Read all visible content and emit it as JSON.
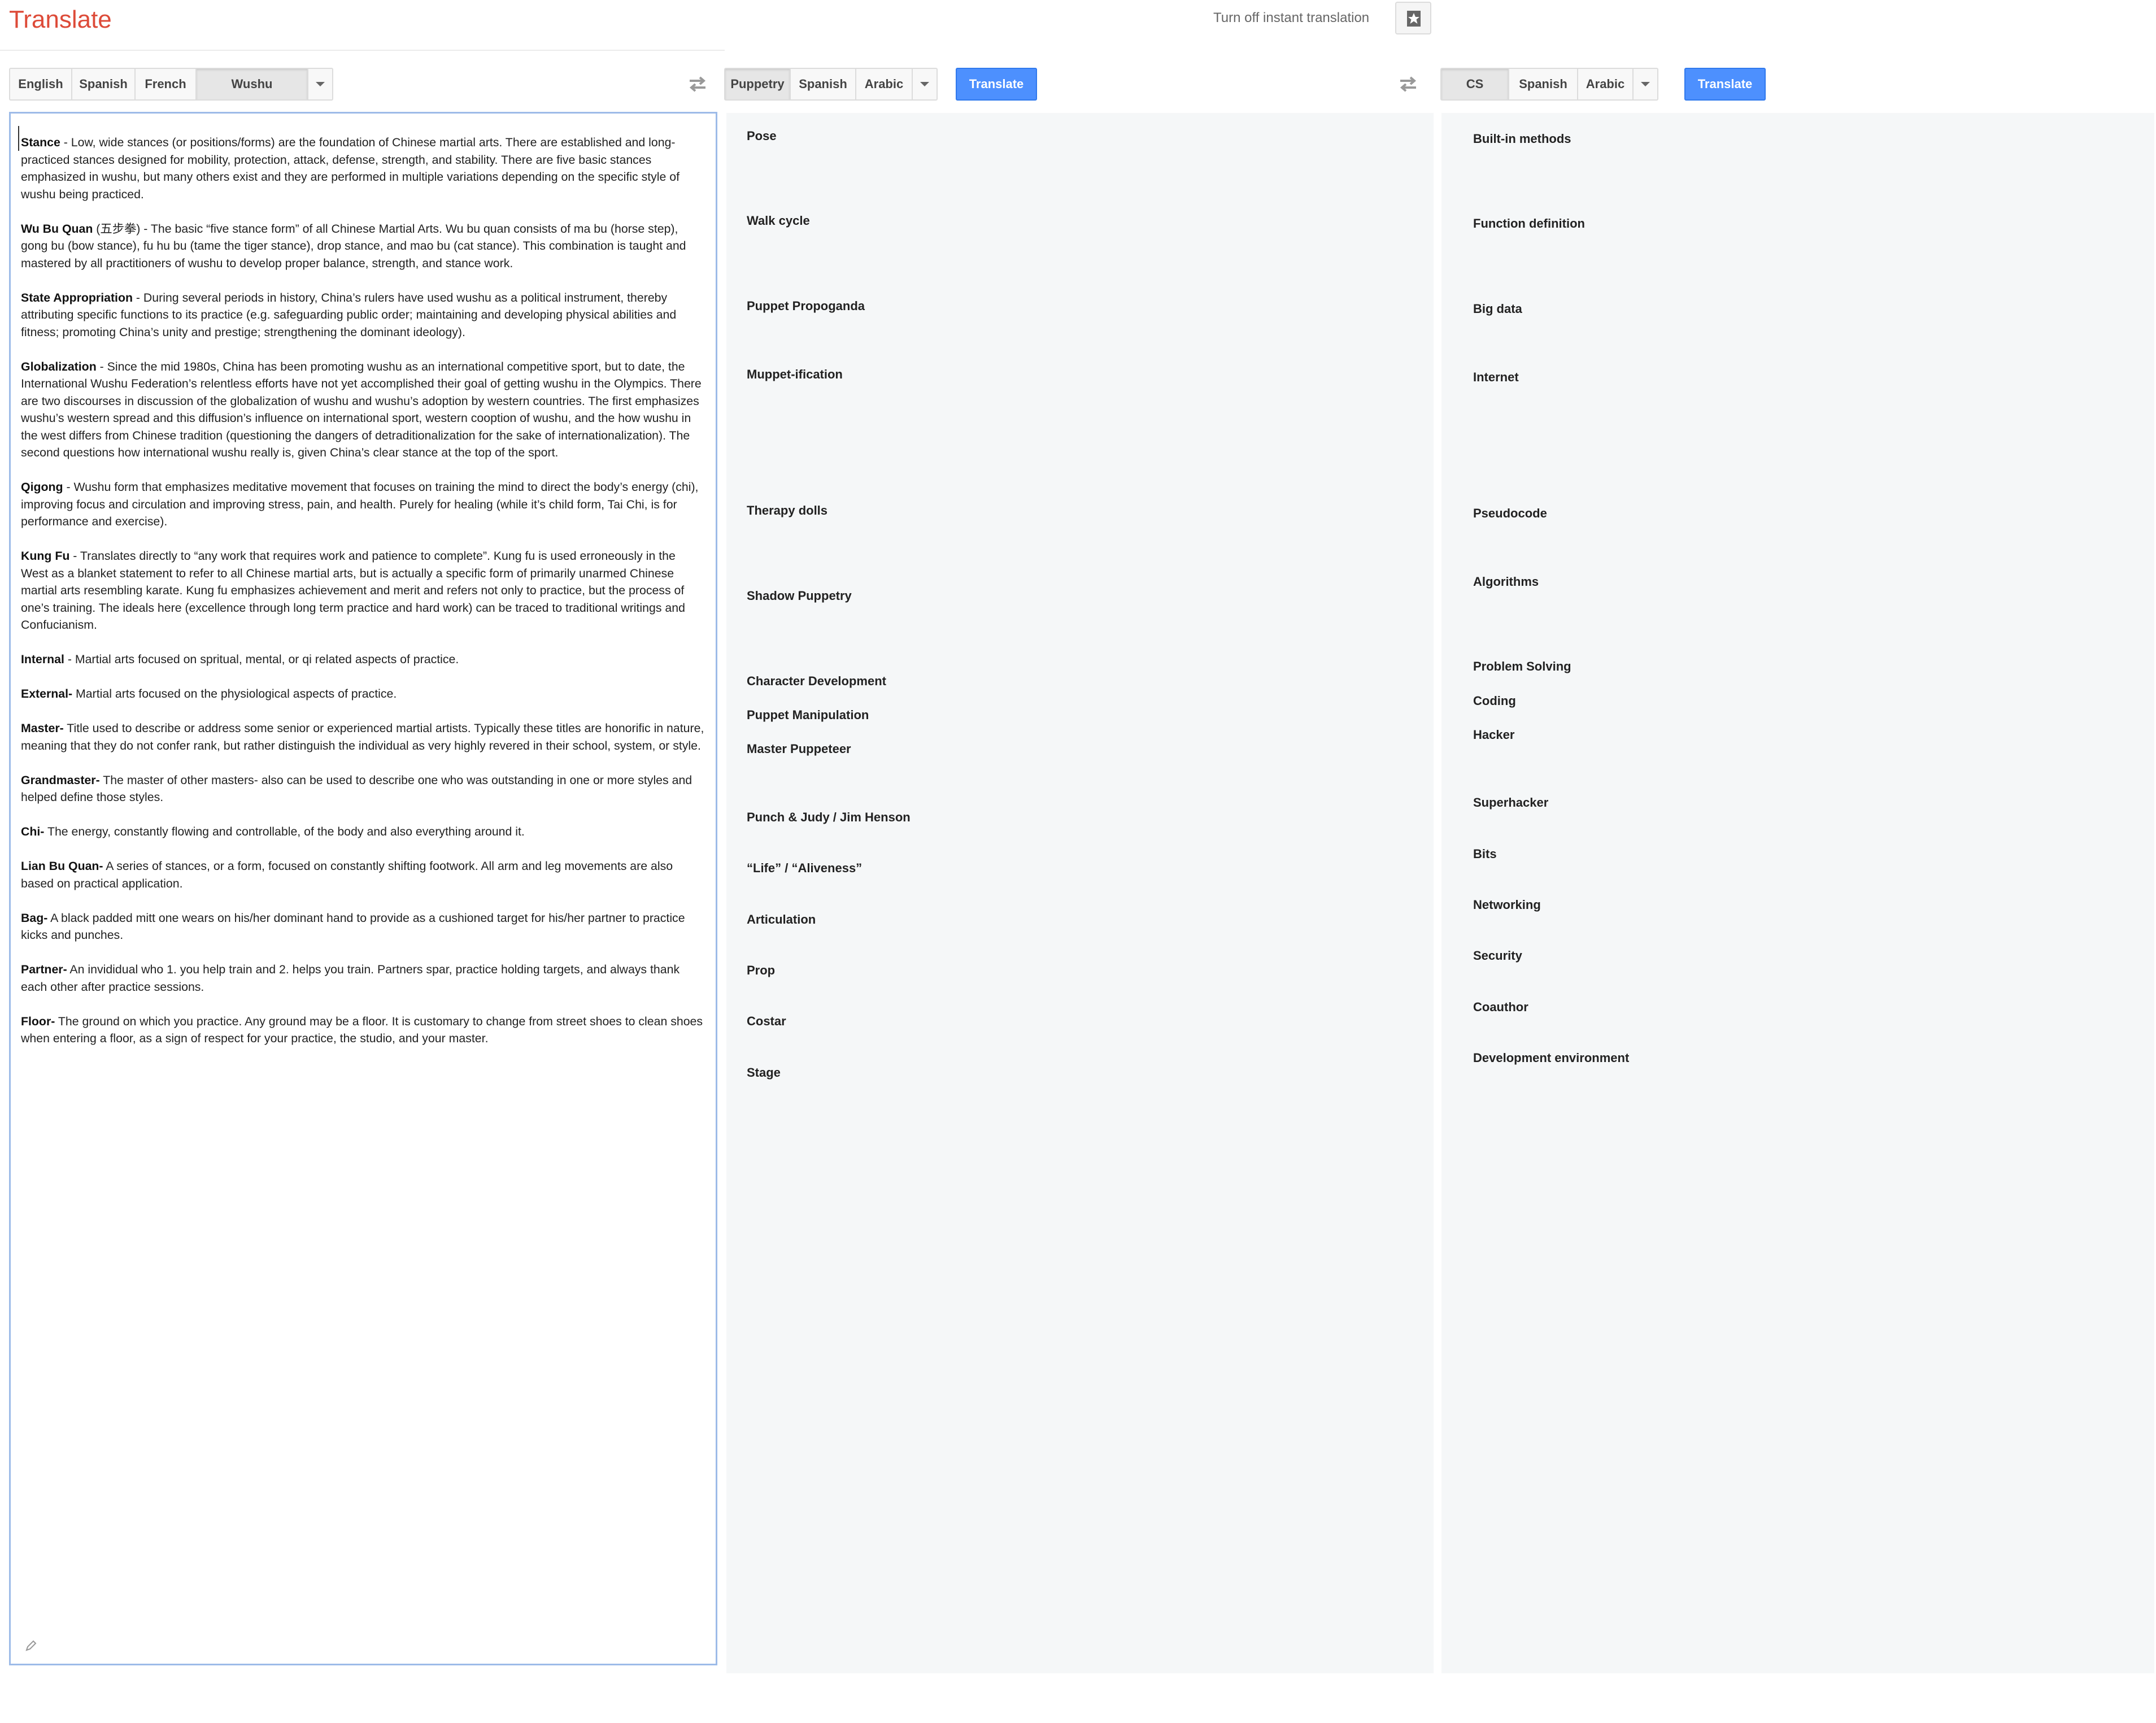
{
  "app": {
    "title": "Translate"
  },
  "header": {
    "instant_translation_link": "Turn off instant translation"
  },
  "source": {
    "languages": [
      {
        "label": "English"
      },
      {
        "label": "Spanish"
      },
      {
        "label": "French"
      },
      {
        "label": "Wushu",
        "selected": true
      }
    ],
    "entries": [
      {
        "term": "Stance",
        "text": " - Low, wide stances (or positions/forms) are the foundation of Chinese martial arts. There are established and long-practiced stances designed for mobility, protection, attack, defense, strength, and stability. There are five basic stances emphasized in wushu, but many others exist and they are performed in multiple variations depending on the specific style of wushu being practiced."
      },
      {
        "term": "Wu Bu Quan",
        "text": " (五步拳) - The basic “five stance form” of all Chinese Martial Arts. Wu bu quan consists of ma bu (horse step), gong bu (bow stance), fu hu bu (tame the tiger stance), drop stance, and mao bu (cat stance). This combination is taught and mastered by all practitioners of wushu to develop proper balance, strength, and stance work."
      },
      {
        "term": "State Appropriation",
        "text": " - During several periods in history, China’s rulers have used wushu as a political instrument, thereby attributing specific functions to its practice (e.g. safeguarding public order; maintaining and developing physical abilities and fitness; promoting China’s unity and prestige; strengthening the dominant ideology)."
      },
      {
        "term": "Globalization",
        "text": " - Since the mid 1980s, China has been promoting wushu as an international competitive sport, but to date, the International Wushu Federation’s relentless efforts have not yet accomplished their goal of getting wushu in the Olympics. There are two discourses in discussion of the globalization of wushu and wushu’s adoption by western countries. The first emphasizes wushu’s western spread and this diffusion’s influence on international sport, western cooption of wushu, and the how wushu in the west differs from Chinese tradition (questioning the dangers of detraditionalization for the sake of internationalization). The second questions how international wushu really is, given China’s clear stance at the top of the sport."
      },
      {
        "term": "Qigong",
        "text": " - Wushu form that emphasizes meditative movement that focuses on training the mind to direct the body’s energy (chi), improving focus and circulation and improving stress, pain, and health. Purely for healing (while it’s child form, Tai Chi, is for performance and exercise)."
      },
      {
        "term": "Kung Fu",
        "text": " - Translates directly to “any work that requires work and patience to complete”. Kung fu is used erroneously in the West as a blanket statement to refer to all Chinese martial arts, but is actually a specific form of primarily unarmed Chinese martial arts resembling karate. Kung fu emphasizes achievement and merit and refers not only to practice, but the process of one’s training. The ideals here (excellence through long term practice and hard work) can be traced to traditional writings and Confucianism."
      },
      {
        "term": "Internal",
        "text": " - Martial arts focused on spritual, mental, or qi related aspects of practice."
      },
      {
        "term": "External-",
        "text": " Martial arts focused on the physiological aspects of practice."
      },
      {
        "term": "Master-",
        "text": "  Title used to describe or address some senior or experienced martial artists. Typically these titles are honorific in nature, meaning that they do not confer rank, but rather distinguish the individual as very highly revered in their school, system, or style."
      },
      {
        "term": "Grandmaster-",
        "text": " The master of other masters- also can be used to describe one who was outstanding in one or more styles and helped define those styles."
      },
      {
        "term": "Chi-",
        "text": " The energy, constantly flowing and controllable, of the body and also everything around it."
      },
      {
        "term": "Lian Bu Quan-",
        "text": " A series of stances, or a form, focused on constantly shifting footwork. All arm and leg movements are also based on practical application."
      },
      {
        "term": "Bag-",
        "text": " A black padded mitt one wears on his/her dominant hand to provide as a cushioned target for his/her partner to practice kicks and punches."
      },
      {
        "term": "Partner-",
        "text": " An invididual who 1. you help train and 2. helps you train. Partners spar, practice holding targets, and always thank each other after practice sessions."
      },
      {
        "term": "Floor-",
        "text": " The ground on which you practice. Any ground may be a floor. It is customary to change from street shoes to clean shoes when entering a floor, as a sign of respect for your practice, the studio, and your master."
      }
    ]
  },
  "target1": {
    "languages": [
      {
        "label": "Puppetry",
        "selected": true
      },
      {
        "label": "Spanish"
      },
      {
        "label": "Arabic"
      }
    ],
    "translate_label": "Translate",
    "terms": [
      "Pose",
      "Walk cycle",
      "Puppet Propoganda",
      "Muppet-ification",
      "Therapy dolls",
      "Shadow Puppetry",
      "Character Development",
      "Puppet Manipulation",
      "Master Puppeteer",
      "Punch & Judy / Jim Henson",
      "“Life” / “Aliveness”",
      "Articulation",
      "Prop",
      "Costar",
      "Stage"
    ]
  },
  "target2": {
    "languages": [
      {
        "label": "CS",
        "selected": true
      },
      {
        "label": "Spanish"
      },
      {
        "label": "Arabic"
      }
    ],
    "translate_label": "Translate",
    "terms": [
      "Built-in methods",
      "Function definition",
      "Big data",
      "Internet",
      "Pseudocode",
      "Algorithms",
      "Problem Solving",
      "Coding",
      "Hacker",
      "Superhacker",
      "Bits",
      "Networking",
      "Security",
      "Coauthor",
      "Development environment"
    ]
  },
  "icons": {
    "star": "star-icon",
    "swap": "swap-languages-icon",
    "dropdown": "chevron-down-icon",
    "pencil": "pencil-icon"
  }
}
